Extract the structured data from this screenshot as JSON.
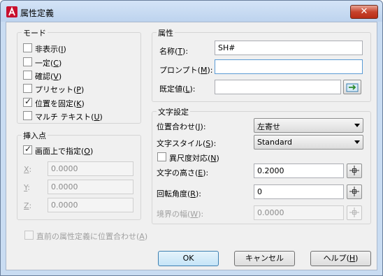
{
  "window": {
    "title": "属性定義",
    "close_label": "✕",
    "accent_color": "#c7432c"
  },
  "mode": {
    "title": "モード",
    "options": [
      {
        "label": "非表示",
        "key": "I",
        "checked": false
      },
      {
        "label": "一定",
        "key": "C",
        "checked": false
      },
      {
        "label": "確認",
        "key": "V",
        "checked": false
      },
      {
        "label": "プリセット",
        "key": "P",
        "checked": false
      },
      {
        "label": "位置を固定",
        "key": "K",
        "checked": true
      },
      {
        "label": "マルチ テキスト",
        "key": "U",
        "checked": false
      }
    ]
  },
  "insertion": {
    "title": "挿入点",
    "specify_label": "画面上で指定",
    "specify_key": "O",
    "specify_checked": true,
    "x_label": "X",
    "x_value": "0.0000",
    "y_label": "Y",
    "y_value": "0.0000",
    "z_label": "Z",
    "z_value": "0.0000"
  },
  "attribute": {
    "title": "属性",
    "tag_label": "名称",
    "tag_key": "T",
    "tag_value": "SH#",
    "prompt_label": "プロンプト",
    "prompt_key": "M",
    "prompt_value": "",
    "default_label": "既定値",
    "default_key": "L",
    "default_value": ""
  },
  "text_settings": {
    "title": "文字設定",
    "justify_label": "位置合わせ",
    "justify_key": "J",
    "justify_value": "左寄せ",
    "style_label": "文字スタイル",
    "style_key": "S",
    "style_value": "Standard",
    "annotative_label": "異尺度対応",
    "annotative_key": "N",
    "annotative_checked": false,
    "height_label": "文字の高さ",
    "height_key": "E",
    "height_value": "0.2000",
    "rotation_label": "回転角度",
    "rotation_key": "R",
    "rotation_value": "0",
    "width_label": "境界の幅",
    "width_key": "W",
    "width_value": "0.0000"
  },
  "align_below": {
    "label": "直前の属性定義に位置合わせ",
    "key": "A",
    "checked": false
  },
  "buttons": {
    "ok": "OK",
    "cancel": "キャンセル",
    "help": "ヘルプ",
    "help_key": "H"
  }
}
